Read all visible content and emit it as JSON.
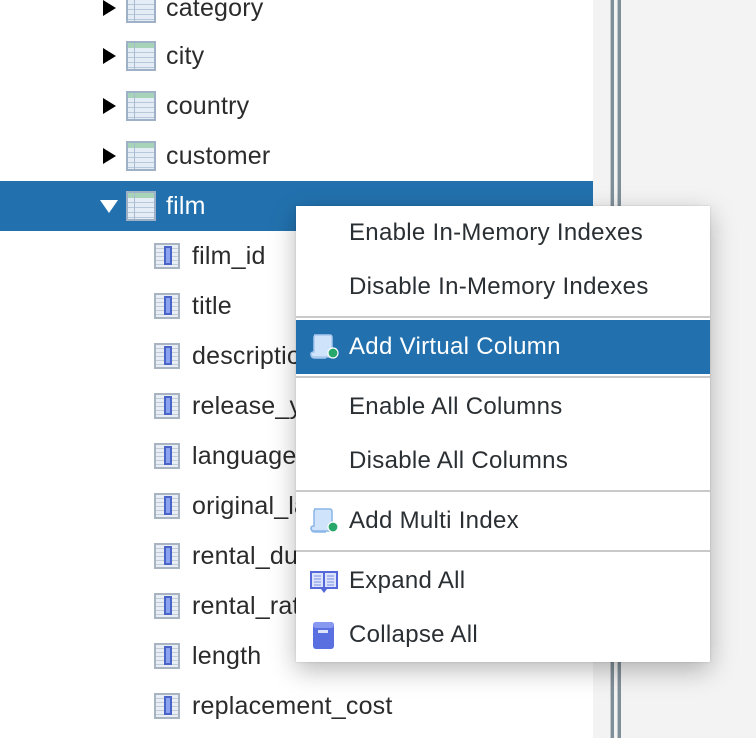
{
  "tree": {
    "tables": [
      {
        "name": "category",
        "expanded": false
      },
      {
        "name": "city",
        "expanded": false
      },
      {
        "name": "country",
        "expanded": false
      },
      {
        "name": "customer",
        "expanded": false
      },
      {
        "name": "film",
        "expanded": true,
        "selected": true
      }
    ],
    "film_columns": [
      "film_id",
      "title",
      "description",
      "release_year",
      "language_id",
      "original_language_id",
      "rental_duration",
      "rental_rate",
      "length",
      "replacement_cost"
    ]
  },
  "context_menu": {
    "items": [
      {
        "label": "Enable In-Memory Indexes",
        "icon": null
      },
      {
        "label": "Disable In-Memory Indexes",
        "icon": null
      },
      {
        "label": "Add Virtual Column",
        "icon": "scroll-add-icon",
        "highlighted": true
      },
      {
        "label": "Enable All Columns",
        "icon": null
      },
      {
        "label": "Disable All Columns",
        "icon": null
      },
      {
        "label": "Add Multi Index",
        "icon": "scroll-add-icon"
      },
      {
        "label": "Expand All",
        "icon": "open-book-icon"
      },
      {
        "label": "Collapse All",
        "icon": "closed-book-icon"
      }
    ]
  },
  "colors": {
    "selection": "#2271ae",
    "menu_text": "#2a2f33",
    "tree_text": "#2b2b2b",
    "panel_bg": "#f3f3f3"
  }
}
